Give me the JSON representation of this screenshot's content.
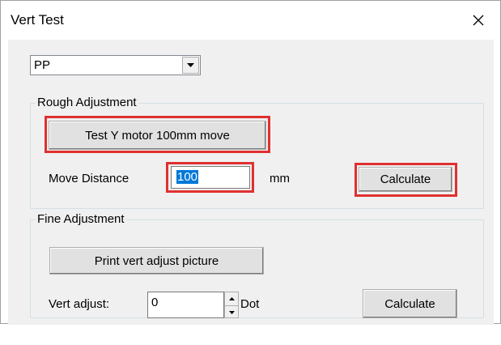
{
  "window": {
    "title": "Vert Test",
    "close_icon": "close-icon"
  },
  "combo": {
    "value": "PP",
    "arrow_icon": "dropdown-arrow-icon"
  },
  "rough": {
    "legend": "Rough Adjustment",
    "test_button": "Test Y motor 100mm move",
    "move_distance_label": "Move Distance",
    "move_distance_value": "100",
    "unit": "mm",
    "calculate_button": "Calculate"
  },
  "fine": {
    "legend": "Fine Adjustment",
    "print_button": "Print vert adjust picture",
    "vert_adjust_label": "Vert adjust:",
    "vert_adjust_value": "0",
    "unit": "Dot",
    "calculate_button": "Calculate"
  },
  "colors": {
    "highlight": "#e03030",
    "selection": "#0078d7"
  }
}
